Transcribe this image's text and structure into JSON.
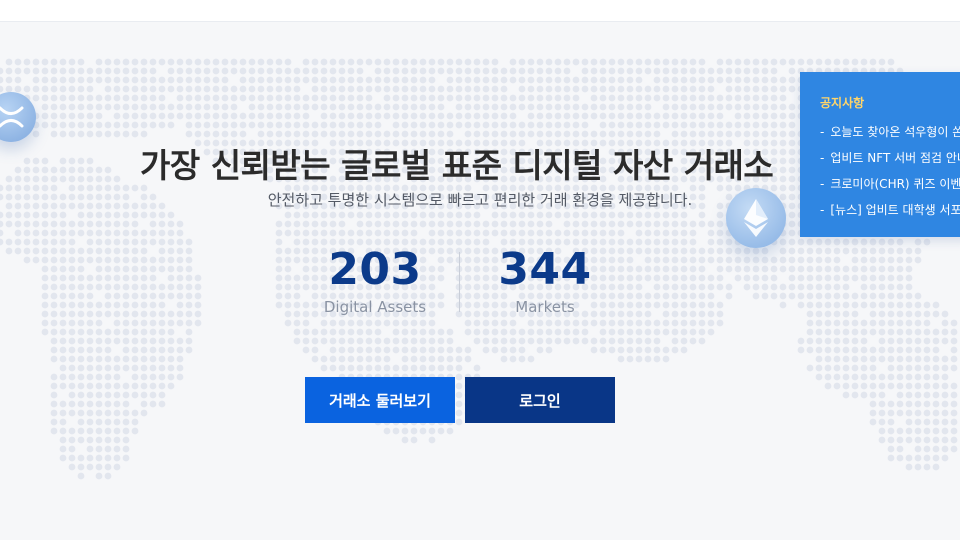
{
  "hero": {
    "headline": "가장 신뢰받는 글로벌 표준 디지털 자산 거래소",
    "subline": "안전하고 투명한 시스템으로 빠르고 편리한 거래 환경을 제공합니다."
  },
  "stats": [
    {
      "value": "203",
      "label": "Digital Assets"
    },
    {
      "value": "344",
      "label": "Markets"
    }
  ],
  "buttons": {
    "explore": "거래소 둘러보기",
    "login": "로그인"
  },
  "notice": {
    "title": "공지사항",
    "items": [
      "오늘도 찾아온 석우형이 쏜다",
      "업비트 NFT 서버 점검 안내",
      "크로미아(CHR) 퀴즈 이벤트",
      "[뉴스] 업비트 대학생 서포터즈"
    ]
  },
  "colors": {
    "primary": "#0a63e0",
    "navy": "#093687",
    "notice_bg": "#2f86e2",
    "notice_title": "#ffd56a",
    "stat_number": "#0b3a8a"
  },
  "icons": {
    "xrp": "xrp-coin-icon",
    "eth": "ethereum-coin-icon"
  }
}
